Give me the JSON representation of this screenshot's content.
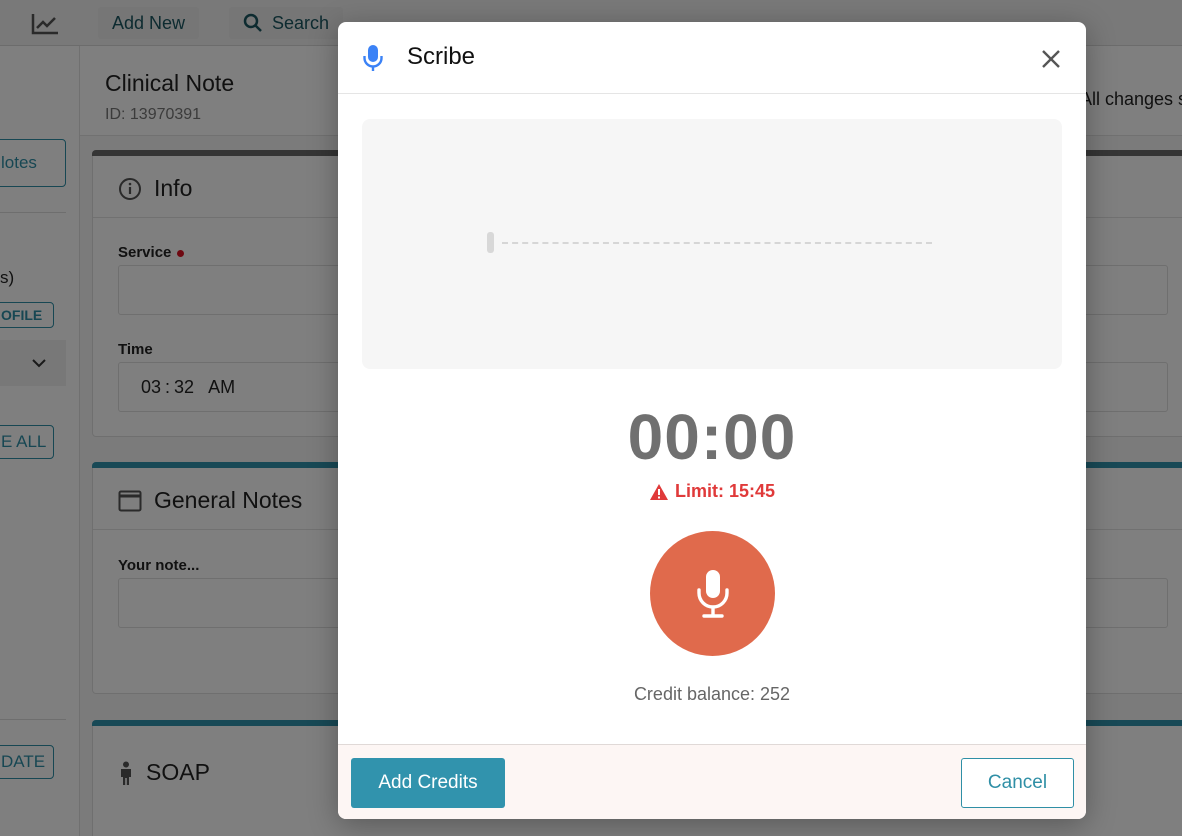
{
  "topbar": {
    "chart_icon": "chart-line-icon",
    "add_new": "Add New",
    "search": "Search"
  },
  "rail": {
    "notes_btn": "lotes",
    "fragment_s": "s)",
    "profile_btn": "OFILE",
    "all_btn": "E ALL",
    "date_btn": "DATE"
  },
  "note": {
    "title": "Clinical Note",
    "id": "ID: 13970391",
    "saved_status": "All changes s"
  },
  "info": {
    "heading": "Info",
    "service_label": "Service",
    "time_label": "Time",
    "time_hour": "03",
    "time_min": "32",
    "time_ampm": "AM"
  },
  "general": {
    "heading": "General Notes",
    "note_label": "Your note..."
  },
  "soap": {
    "heading": "SOAP"
  },
  "modal": {
    "title": "Scribe",
    "timer": "00:00",
    "limit": "Limit: 15:45",
    "credit_balance": "Credit balance: 252",
    "add_credits": "Add Credits",
    "cancel": "Cancel"
  },
  "colors": {
    "accent": "#3193ad",
    "record": "#e06a4c",
    "warning": "#e03a3a",
    "mic_blue": "#3b82f6"
  }
}
